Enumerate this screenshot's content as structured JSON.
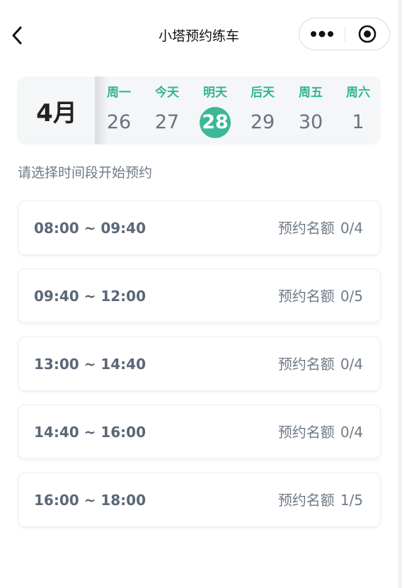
{
  "navbar": {
    "title": "小塔预约练车",
    "back_icon": "chevron-left-icon",
    "more_icon": "more-dots-icon",
    "close_icon": "record-circle-icon"
  },
  "calendar": {
    "month": "4月",
    "days": [
      {
        "label": "周一",
        "date": "26",
        "selected": false
      },
      {
        "label": "今天",
        "date": "27",
        "selected": false
      },
      {
        "label": "明天",
        "date": "28",
        "selected": true
      },
      {
        "label": "后天",
        "date": "29",
        "selected": false
      },
      {
        "label": "周五",
        "date": "30",
        "selected": false
      },
      {
        "label": "周六",
        "date": "1",
        "selected": false
      }
    ],
    "accent_color": "#3bb897"
  },
  "hint": "请选择时间段开始预约",
  "slots": [
    {
      "time": "08:00 ~ 09:40",
      "quota_label": "预约名额",
      "quota": "0/4"
    },
    {
      "time": "09:40 ~ 12:00",
      "quota_label": "预约名额",
      "quota": "0/5"
    },
    {
      "time": "13:00 ~ 14:40",
      "quota_label": "预约名额",
      "quota": "0/4"
    },
    {
      "time": "14:40 ~ 16:00",
      "quota_label": "预约名额",
      "quota": "0/4"
    },
    {
      "time": "16:00 ~ 18:00",
      "quota_label": "预约名额",
      "quota": "1/5"
    }
  ]
}
